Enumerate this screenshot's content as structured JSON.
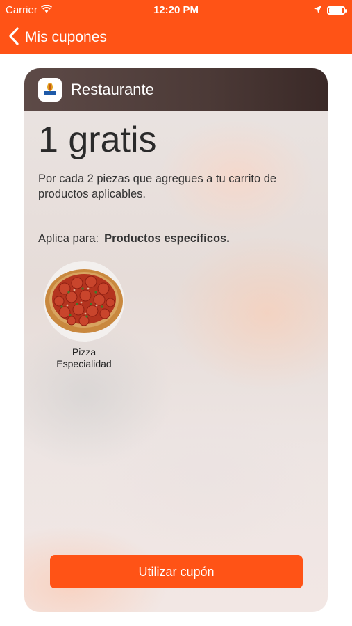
{
  "status_bar": {
    "carrier": "Carrier",
    "time": "12:20 PM",
    "battery_level": 0.95
  },
  "nav": {
    "back_label": "Mis cupones"
  },
  "coupon": {
    "store_name": "Restaurante",
    "headline": "1 gratis",
    "description": "Por cada 2 piezas que agregues a tu carrito de productos aplicables.",
    "applies_label": "Aplica para:",
    "applies_value": "Productos específicos.",
    "products": [
      {
        "name_line1": "Pizza",
        "name_line2": "Especialidad"
      }
    ],
    "use_button": "Utilizar cupón"
  },
  "colors": {
    "accent": "#ff5316",
    "header_bg": "#4c3a37"
  },
  "icons": {
    "wifi": "wifi-icon",
    "location": "location-arrow-icon",
    "battery": "battery-icon",
    "back": "chevron-left-icon",
    "logo": "restaurant-logo-icon"
  }
}
